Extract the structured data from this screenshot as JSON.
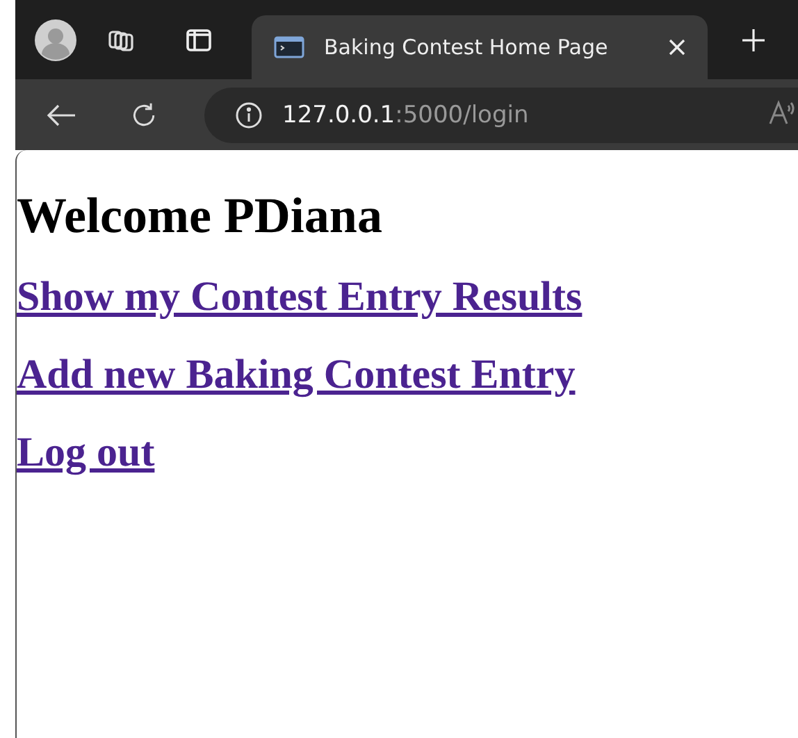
{
  "browser": {
    "tab": {
      "title": "Baking Contest Home Page",
      "selected": true
    },
    "address": {
      "host": "127.0.0.1",
      "path": ":5000/login"
    }
  },
  "page": {
    "heading": "Welcome PDiana",
    "links": [
      {
        "label": "Show my Contest Entry Results",
        "visited": true
      },
      {
        "label": "Add new Baking Contest Entry",
        "visited": true
      },
      {
        "label": "Log out",
        "visited": true
      }
    ]
  }
}
